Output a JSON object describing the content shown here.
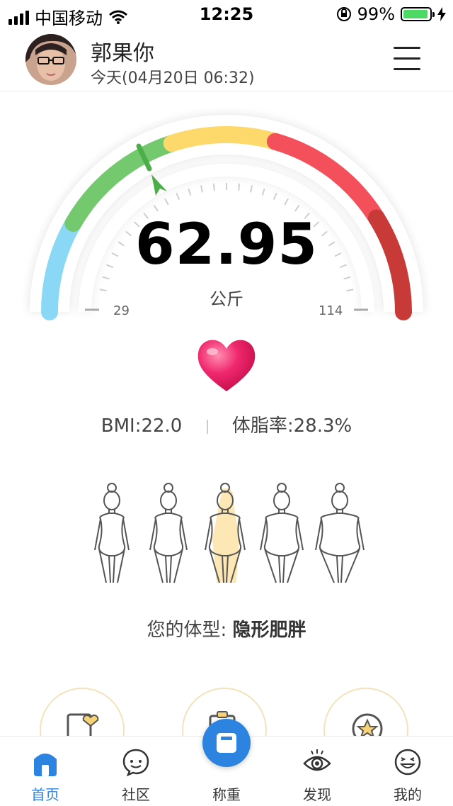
{
  "status": {
    "carrier": "中国移动",
    "time": "12:25",
    "battery": "99%",
    "battery_level": 0.99
  },
  "profile": {
    "name": "郭果你",
    "date": "今天(04月20日 06:32)"
  },
  "gauge": {
    "weight": "62.95",
    "unit": "公斤",
    "min": "29",
    "max": "114",
    "colors": [
      "#8bd8f6",
      "#74c96e",
      "#fdd86a",
      "#f4505c",
      "#c83a38"
    ]
  },
  "metrics": {
    "bmi": "BMI:22.0",
    "body_fat": "体脂率:28.3%"
  },
  "body_type": {
    "label": "您的体型: ",
    "value": "隐形肥胖",
    "highlight_color": "#fde7b4"
  },
  "tabs": [
    {
      "label": "首页",
      "icon": "home-icon",
      "active": true
    },
    {
      "label": "社区",
      "icon": "chat-icon",
      "active": false
    },
    {
      "label": "称重",
      "icon": "scale-icon",
      "active": false
    },
    {
      "label": "发现",
      "icon": "eye-icon",
      "active": false
    },
    {
      "label": "我的",
      "icon": "smile-icon",
      "active": false
    }
  ],
  "accent_color": "#2d84e0"
}
